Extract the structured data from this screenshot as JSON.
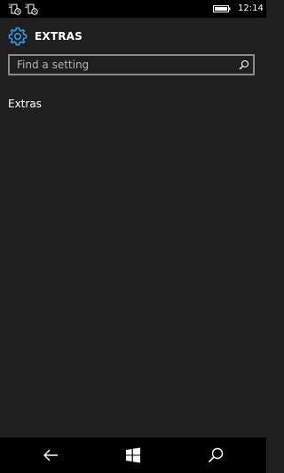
{
  "status_bar": {
    "time": "12:14",
    "sim1_label": "1",
    "sim2_label": "2",
    "icons": [
      "sim1-signal-icon",
      "sim2-signal-icon",
      "battery-icon"
    ]
  },
  "header": {
    "title": "EXTRAS",
    "icon": "gear-icon",
    "accent_color": "#2b9ee9"
  },
  "search": {
    "placeholder": "Find a setting",
    "value": "",
    "icon": "search-icon"
  },
  "items": [
    {
      "label": "Extras"
    }
  ],
  "nav_bar": {
    "buttons": [
      "back-icon",
      "windows-icon",
      "search-icon"
    ]
  }
}
